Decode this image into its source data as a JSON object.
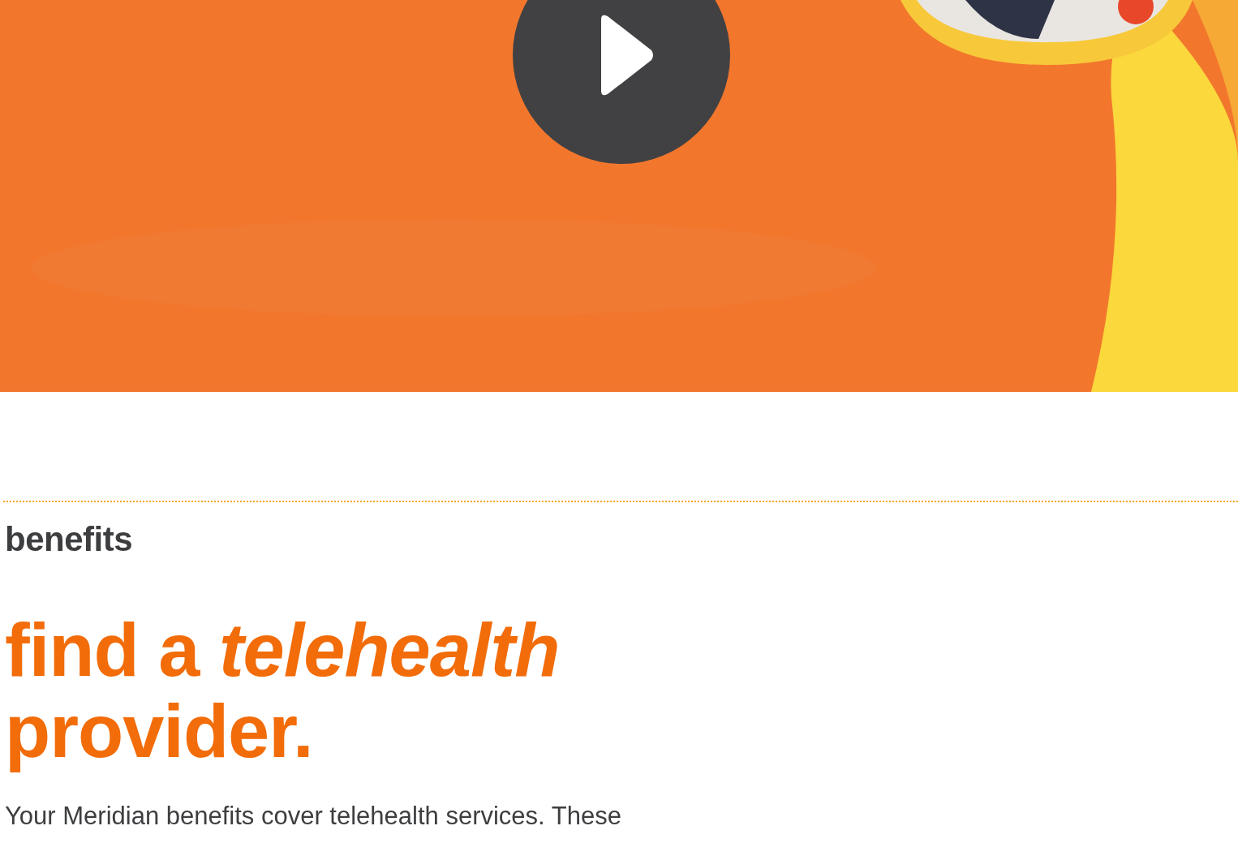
{
  "section": {
    "eyebrow": "benefits",
    "heading": "find a *telehealth* provider.",
    "body": "Your Meridian benefits cover telehealth services. These"
  }
}
